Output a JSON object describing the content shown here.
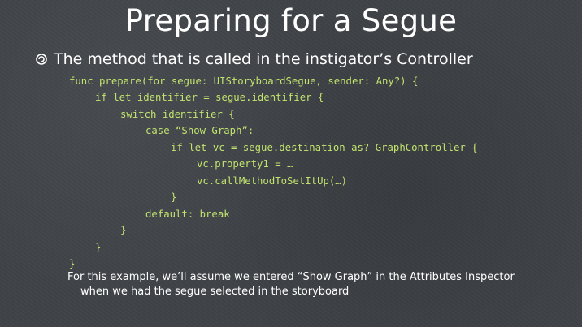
{
  "slide": {
    "title": "Preparing for a Segue",
    "bullet": "The method that is called in the instigator’s Controller",
    "code_lines": [
      "func prepare(for segue: UIStoryboardSegue, sender: Any?) {",
      "if let identifier = segue.identifier {",
      "switch identifier {",
      "case “Show Graph”:",
      "if let vc = segue.destination as? GraphController {",
      "vc.property1 = …",
      "vc.callMethodToSetItUp(…)",
      "}",
      "default: break",
      "}",
      "}",
      "}"
    ],
    "note_line1": "For this example, we’ll assume we entered “Show Graph” in the Attributes Inspector",
    "note_line2": "when we had the segue selected in the storyboard"
  },
  "colors": {
    "background": "#3f4347",
    "text": "#ffffff",
    "code": "#c2e36f"
  },
  "icons": {
    "bullet": "spiral-bullet-icon"
  }
}
